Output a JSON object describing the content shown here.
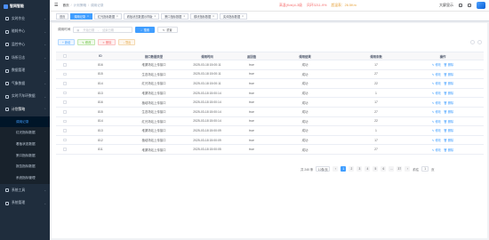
{
  "app": {
    "logo_text": "智网智能"
  },
  "sidebar": {
    "items": [
      {
        "label": "实时作业",
        "icon": "monitor-icon"
      },
      {
        "label": "能耗中心",
        "icon": "energy-icon"
      },
      {
        "label": "监控中心",
        "icon": "video-icon"
      },
      {
        "label": "场所日志",
        "icon": "log-icon"
      },
      {
        "label": "数据管理",
        "icon": "data-icon"
      },
      {
        "label": "气象数据",
        "icon": "weather-icon"
      },
      {
        "label": "实时汽车环数据",
        "icon": "car-icon"
      },
      {
        "label": "计划策略",
        "icon": "plan-icon"
      }
    ],
    "submenu": [
      {
        "label": "调用记录",
        "active": true
      },
      {
        "label": "红光指标数据",
        "active": false
      },
      {
        "label": "看板状态数据",
        "active": false
      },
      {
        "label": "策口指标数据",
        "active": false
      },
      {
        "label": "报告指标数据",
        "active": false
      },
      {
        "label": "系统指标管理",
        "active": false
      }
    ],
    "bottom_items": [
      {
        "label": "系统工具",
        "icon": "tool-icon"
      },
      {
        "label": "系统管理",
        "icon": "settings-icon"
      }
    ]
  },
  "header": {
    "breadcrumb": [
      "首页",
      "计划策略",
      "调用记录"
    ],
    "alert_1": "高温(Kds)4-3级",
    "alert_2": "风环3211-9%",
    "alert_3": "超温表：26.5Km",
    "user_name": "大屏显示"
  },
  "tags": [
    {
      "label": "首页",
      "active": false
    },
    {
      "label": "调用记录",
      "active": true
    },
    {
      "label": "红光指标数据",
      "active": false
    },
    {
      "label": "看板状态数据示样版",
      "active": false
    },
    {
      "label": "策口指标数据",
      "active": false
    },
    {
      "label": "模块指标数据",
      "active": false
    },
    {
      "label": "实体指标数据",
      "active": false
    }
  ],
  "search": {
    "label": "调用时间",
    "start_placeholder": "开始日期",
    "separator": "-",
    "end_placeholder": "结束日期",
    "search_btn": "搜索",
    "reset_btn": "重置"
  },
  "ops": {
    "add": "新增",
    "edit": "修改",
    "delete": "删除",
    "export": "导出"
  },
  "table": {
    "columns": [
      "ID",
      "接口数据类型",
      "调用时间",
      "返回值",
      "调用结果",
      "调用条数",
      "操作"
    ],
    "rows": [
      [
        "816",
        "堆渠场站上传接口",
        "2025-03-18 15:00:11",
        "true",
        "成功",
        "17"
      ],
      [
        "815",
        "生态场站上传接口",
        "2025-03-18 15:00:11",
        "true",
        "成功",
        "27"
      ],
      [
        "814",
        "红光场站上传接口",
        "2025-03-18 15:00:11",
        "true",
        "成功",
        "22"
      ],
      [
        "813",
        "堆渠场站上传接口",
        "2025-03-18 15:00:14",
        "true",
        "成功",
        "1"
      ],
      [
        "816",
        "植培场站上传接口",
        "2025-03-18 15:00:14",
        "true",
        "成功",
        "17"
      ],
      [
        "815",
        "生态场站上传接口",
        "2025-03-18 15:00:14",
        "true",
        "成功",
        "27"
      ],
      [
        "814",
        "红光场站上传接口",
        "2025-03-18 15:00:14",
        "true",
        "成功",
        "22"
      ],
      [
        "813",
        "堆渠场站上传接口",
        "2025-03-18 15:00:09",
        "true",
        "成功",
        "1"
      ],
      [
        "812",
        "植培场站上传接口",
        "2025-03-18 15:00:09",
        "true",
        "成功",
        "17"
      ],
      [
        "811",
        "堆渠场站上传接口",
        "2025-03-18 15:00:05",
        "true",
        "成功",
        "27"
      ]
    ],
    "action_edit": "修改",
    "action_delete": "删除"
  },
  "pagination": {
    "total": "共 240 条",
    "page_size": "10条/页",
    "pages": [
      "1",
      "2",
      "3",
      "4",
      "5",
      "6",
      "...",
      "37"
    ],
    "current": "1",
    "jump_label": "前往",
    "jump_value": "1",
    "jump_suffix": "页"
  }
}
